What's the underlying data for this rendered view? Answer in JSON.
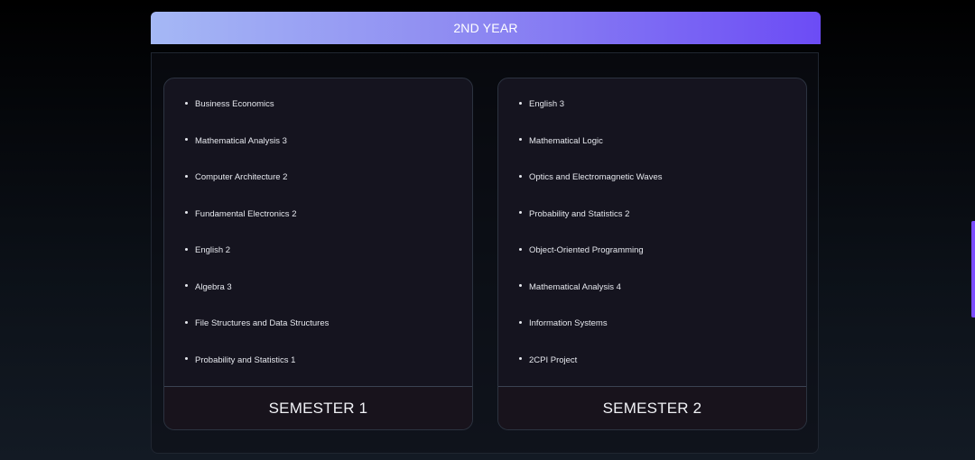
{
  "year": {
    "title": "2ND YEAR"
  },
  "semesters": [
    {
      "title": "SEMESTER 1",
      "courses": [
        "Business Economics",
        "Mathematical Analysis 3",
        "Computer Architecture 2",
        "Fundamental Electronics 2",
        "English 2",
        "Algebra 3",
        "File Structures and Data Structures",
        "Probability and Statistics 1"
      ]
    },
    {
      "title": "SEMESTER 2",
      "courses": [
        "English 3",
        "Mathematical Logic",
        "Optics and Electromagnetic Waves",
        "Probability and Statistics 2",
        "Object-Oriented Programming",
        "Mathematical Analysis 4",
        "Information Systems",
        "2CPI Project"
      ]
    }
  ],
  "colors": {
    "header_gradient_start": "#a5b8f5",
    "header_gradient_end": "#6c4cf5",
    "card_background": "#15141f",
    "scrollbar_accent": "#7b4dff"
  }
}
